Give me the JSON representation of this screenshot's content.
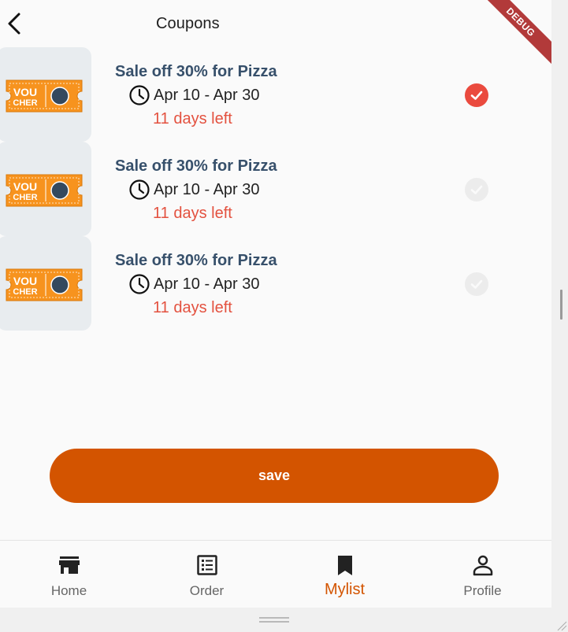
{
  "header": {
    "title": "Coupons",
    "back_icon": "arrow-back-icon"
  },
  "debug_banner": "DEBUG",
  "coupons": [
    {
      "image_text_top": "VOU",
      "image_text_bottom": "CHER",
      "title": "Sale off 30% for Pizza",
      "dates": "Apr 10 - Apr 30",
      "days_left": "11 days left",
      "selected": true
    },
    {
      "image_text_top": "VOU",
      "image_text_bottom": "CHER",
      "title": "Sale off 30% for Pizza",
      "dates": "Apr 10 - Apr 30",
      "days_left": "11 days left",
      "selected": false
    },
    {
      "image_text_top": "VOU",
      "image_text_bottom": "CHER",
      "title": "Sale off 30% for Pizza",
      "dates": "Apr 10 - Apr 30",
      "days_left": "11 days left",
      "selected": false
    }
  ],
  "save_button": {
    "label": "save"
  },
  "bottom_nav": {
    "items": [
      {
        "label": "Home",
        "icon": "store-icon",
        "active": false
      },
      {
        "label": "Order",
        "icon": "list-icon",
        "active": false
      },
      {
        "label": "Mylist",
        "icon": "bookmark-icon",
        "active": true
      },
      {
        "label": "Profile",
        "icon": "person-icon",
        "active": false
      }
    ]
  },
  "colors": {
    "accent": "#d35400",
    "check_selected": "#ea4a3e",
    "days_left": "#e3513f",
    "title_text": "#37506b",
    "voucher_orange": "#f7931e"
  }
}
